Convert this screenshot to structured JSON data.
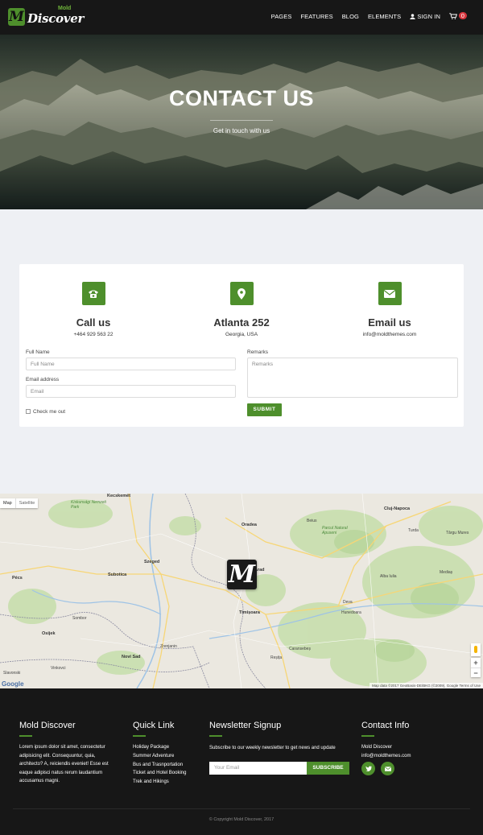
{
  "nav": {
    "logo_text": "Discover",
    "logo_small": "Mold",
    "logo_letter": "M",
    "items": [
      "PAGES",
      "FEATURES",
      "BLOG",
      "ELEMENTS"
    ],
    "signin": "SIGN IN",
    "cart_count": "0"
  },
  "hero": {
    "title": "CONTACT US",
    "subtitle": "Get in touch with us"
  },
  "contact": {
    "blocks": [
      {
        "title": "Call us",
        "value": "+464 929 563 22",
        "icon": "phone-icon"
      },
      {
        "title": "Atlanta 252",
        "value": "Georgia, USA",
        "icon": "map-pin-icon"
      },
      {
        "title": "Email us",
        "value": "info@moldthemes.com",
        "icon": "mail-icon"
      }
    ],
    "form": {
      "name_label": "Full Name",
      "name_placeholder": "Full Name",
      "email_label": "Email address",
      "email_placeholder": "Email",
      "remarks_label": "Remarks",
      "remarks_placeholder": "Remarks",
      "check_label": "Check me out",
      "submit": "SUBMIT"
    }
  },
  "map": {
    "tab_map": "Map",
    "tab_satellite": "Satellite",
    "marker_letter": "M",
    "zoom_in": "+",
    "zoom_out": "−",
    "credit": "Map data ©2017 GeoBasis-DE/BKG (©2009), Google    Terms of Use",
    "google": "Google",
    "towns": [
      "Kecskemét",
      "Szeged",
      "Subotica",
      "Timișoara",
      "Arad",
      "Oradea",
      "Cluj-Napoca",
      "Deva",
      "Alba Iulia",
      "Hunedoara",
      "Zrenjanin",
      "Novi Sad",
      "Osijek",
      "Pécs",
      "Sombor",
      "Reșița",
      "Mediaș",
      "Târgu Mures",
      "Beius",
      "Turda",
      "Slavonski",
      "Vinkovci",
      "Caransebeș",
      "Kiskunsági Nemzeti Park",
      "Parcul Natural Apuseni"
    ]
  },
  "footer": {
    "about": {
      "title": "Mold Discover",
      "text": "Lorem ipsum dolor sit amet, consectetur adipisicing elit. Consequuntur, quia, architecto? A, reiciendis eveniet! Esse est eaque adipisci natus rerum laudantium accusamus magni."
    },
    "quick": {
      "title": "Quick Link",
      "links": [
        "Holiday Package",
        "Summer Adventure",
        "Bus and Trasnportation",
        "Ticket and Hotel Booking",
        "Trek and Hikings"
      ]
    },
    "newsletter": {
      "title": "Newsletter Signup",
      "text": "Subscribe to our weekly newsletter to get news and update",
      "placeholder": "Your Email",
      "button": "SUBSCRIBE"
    },
    "contact": {
      "title": "Contact Info",
      "line1": "Mold Discover",
      "line2": "info@moldthemes.com"
    },
    "copyright": "© Copyright Mold Discover, 2017"
  },
  "colors": {
    "accent": "#4e8f2c",
    "nav_bg": "#171717",
    "page_bg": "#eef0f4",
    "cart_badge": "#d9363e"
  }
}
